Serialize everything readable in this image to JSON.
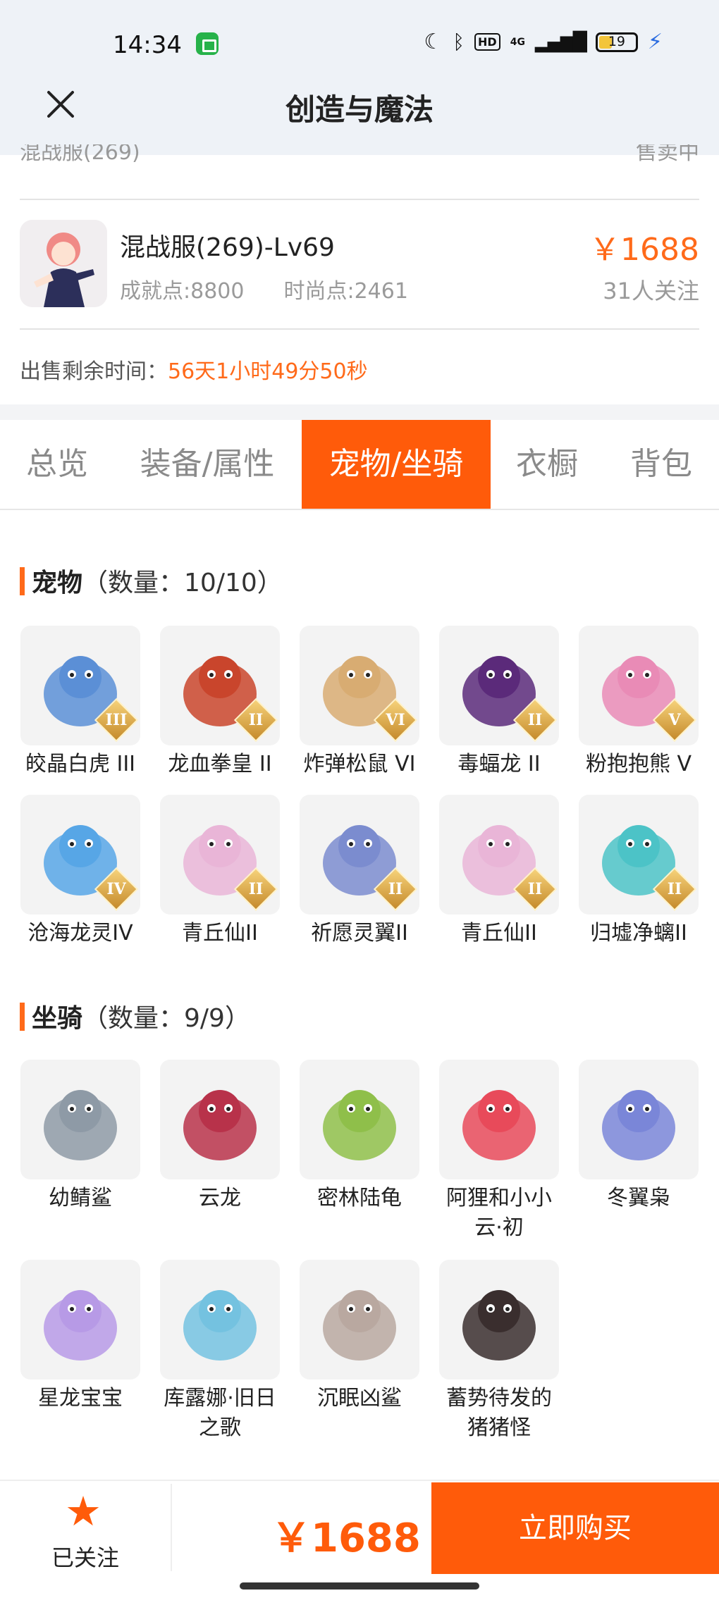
{
  "status_bar": {
    "time": "14:34",
    "battery": "19",
    "network": "4G"
  },
  "header": {
    "title": "创造与魔法"
  },
  "partial_row": {
    "left": "混战服(269)",
    "right": "售卖中"
  },
  "item": {
    "name": "混战服(269)-Lv69",
    "achievement": "成就点:8800",
    "fashion": "时尚点:2461",
    "price": "￥1688",
    "watchers": "31人关注"
  },
  "remain": {
    "label": "出售剩余时间：",
    "value": "56天1小时49分50秒"
  },
  "tabs": [
    {
      "label": "总览"
    },
    {
      "label": "装备/属性"
    },
    {
      "label": "宠物/坐骑"
    },
    {
      "label": "衣橱"
    },
    {
      "label": "背包"
    }
  ],
  "active_tab": "宠物/坐骑",
  "pets": {
    "title": "宠物",
    "count": "（数量：10/10）",
    "items": [
      {
        "name": "皎晶白虎 III",
        "rank": "III",
        "color": "#5b8fd6"
      },
      {
        "name": "龙血拳皇 II",
        "rank": "II",
        "color": "#c9452c"
      },
      {
        "name": "炸弹松鼠 VI",
        "rank": "VI",
        "color": "#d8ac72"
      },
      {
        "name": "毒蝠龙 II",
        "rank": "II",
        "color": "#5b2a7a"
      },
      {
        "name": "粉抱抱熊 V",
        "rank": "V",
        "color": "#e98bb6"
      },
      {
        "name": "沧海龙灵IV",
        "rank": "IV",
        "color": "#57a6e6"
      },
      {
        "name": "青丘仙II",
        "rank": "II",
        "color": "#e9b5d7"
      },
      {
        "name": "祈愿灵翼II",
        "rank": "II",
        "color": "#7b8ccf"
      },
      {
        "name": "青丘仙II",
        "rank": "II",
        "color": "#e9b5d7"
      },
      {
        "name": "归墟净螭II",
        "rank": "II",
        "color": "#4cc3c7"
      }
    ]
  },
  "mounts": {
    "title": "坐骑",
    "count": "（数量：9/9）",
    "items": [
      {
        "name": "幼鲭鲨",
        "color": "#8e9aa6"
      },
      {
        "name": "云龙",
        "color": "#b8324a"
      },
      {
        "name": "密林陆龟",
        "color": "#8fbf4a"
      },
      {
        "name": "阿狸和小小云·初",
        "color": "#e84a5a"
      },
      {
        "name": "冬翼枭",
        "color": "#7a86d8"
      },
      {
        "name": "星龙宝宝",
        "color": "#b79ae6"
      },
      {
        "name": "库露娜·旧日之歌",
        "color": "#74c2e0"
      },
      {
        "name": "沉眠凶鲨",
        "color": "#b9a8a0"
      },
      {
        "name": "蓄势待发的猪猪怪",
        "color": "#3a2e2e"
      }
    ]
  },
  "bottom": {
    "follow_label": "已关注",
    "price": "￥1688",
    "buy_label": "立即购买"
  },
  "colors": {
    "accent": "#ff5b0a",
    "price": "#ff6a1a"
  }
}
